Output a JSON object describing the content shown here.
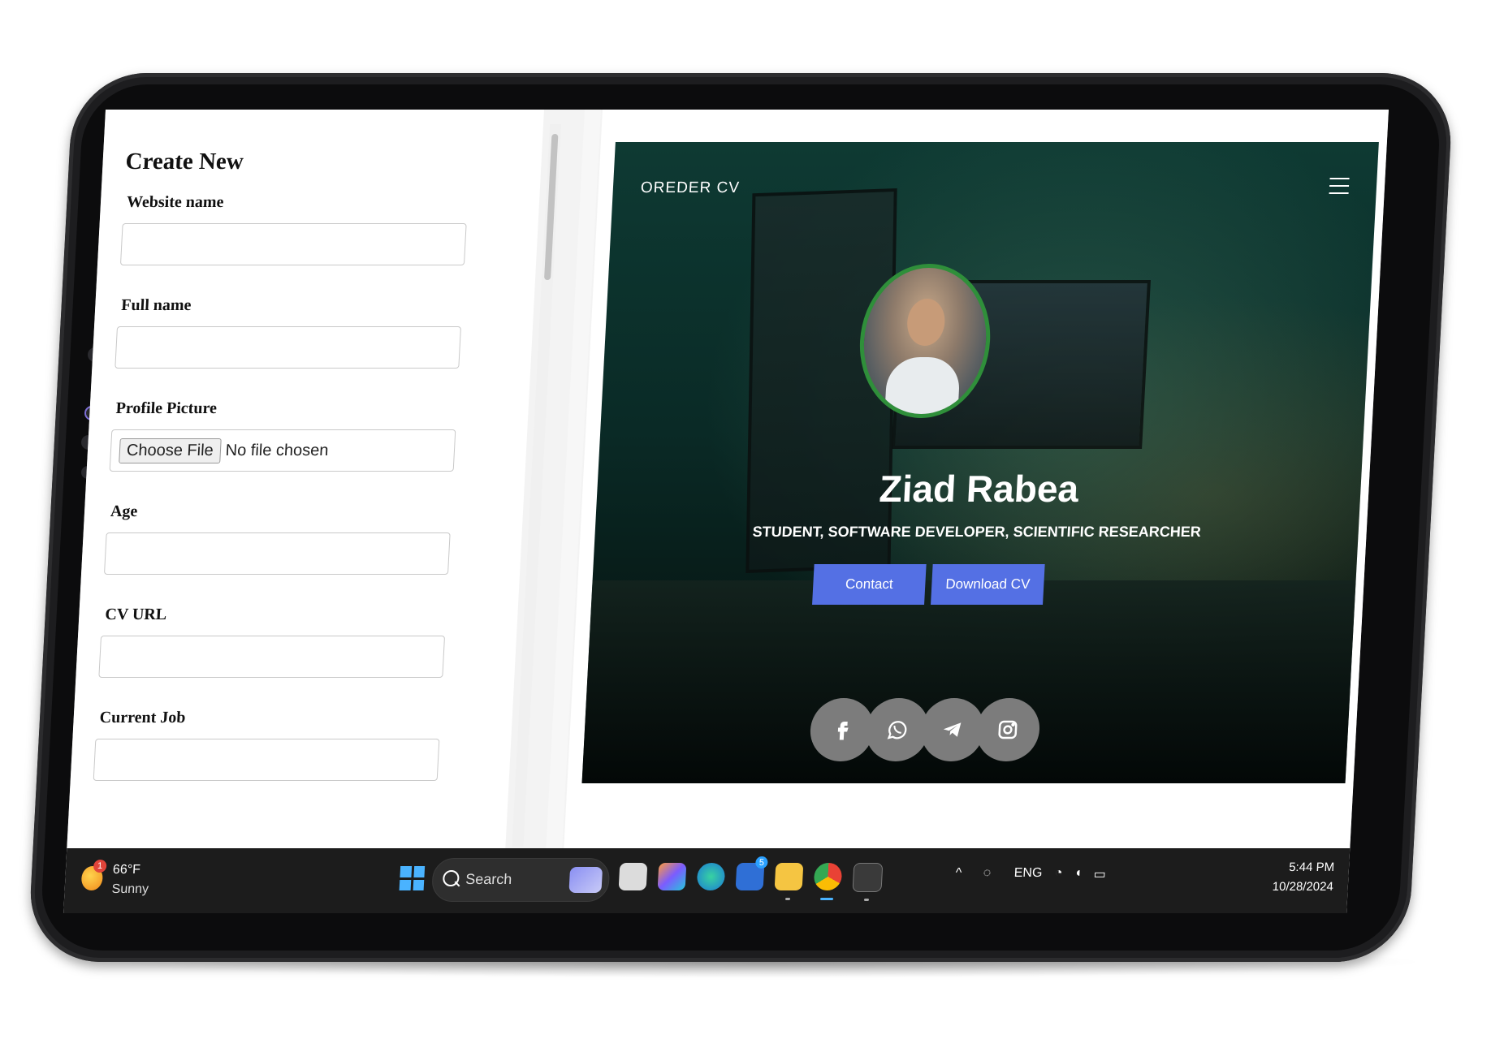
{
  "form": {
    "title": "Create New",
    "fields": [
      {
        "label": "Website name",
        "value": "",
        "placeholder": ""
      },
      {
        "label": "Full name",
        "value": "",
        "placeholder": ""
      },
      {
        "label": "Profile Picture",
        "file_button": "Choose File",
        "file_status": "No file chosen"
      },
      {
        "label": "Age",
        "value": "",
        "placeholder": ""
      },
      {
        "label": "CV URL",
        "value": "",
        "placeholder": ""
      },
      {
        "label": "Current Job",
        "value": "",
        "placeholder": ""
      }
    ]
  },
  "preview": {
    "brand": "OREDER CV",
    "name": "Ziad Rabea",
    "subtitle": "STUDENT, SOFTWARE DEVELOPER, SCIENTIFIC RESEARCHER",
    "buttons": {
      "contact": "Contact",
      "download": "Download CV"
    },
    "social": [
      "facebook-icon",
      "whatsapp-icon",
      "telegram-icon",
      "instagram-icon"
    ],
    "accent_color": "#5470e4",
    "avatar_ring_color": "#2f8f3a"
  },
  "taskbar": {
    "weather": {
      "temp": "66°F",
      "condition": "Sunny",
      "badge": "1"
    },
    "search_label": "Search",
    "tray": {
      "language": "ENG"
    },
    "clock": {
      "time": "5:44 PM",
      "date": "10/28/2024"
    },
    "notification_badge": "5"
  }
}
